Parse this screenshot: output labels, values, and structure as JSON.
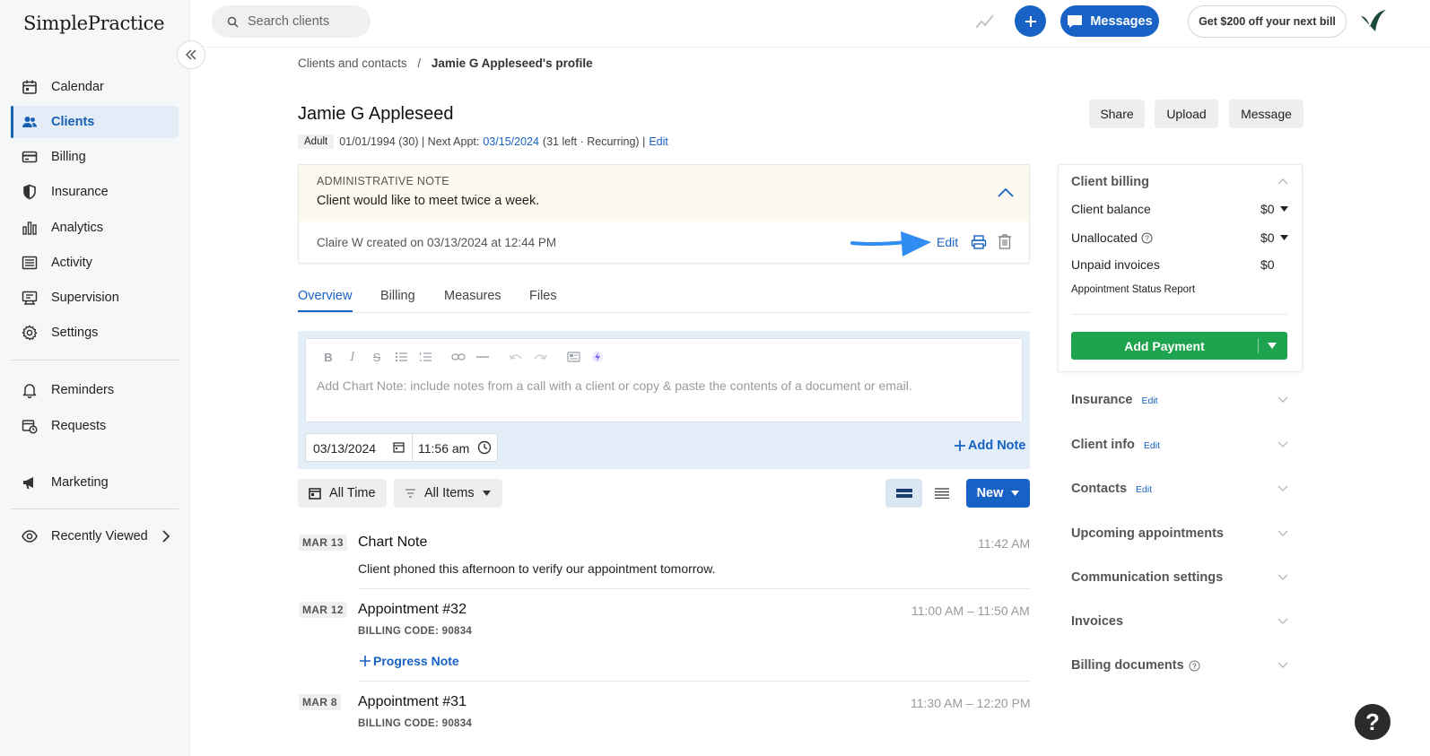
{
  "app": {
    "logo": "SimplePractice",
    "search_placeholder": "Search clients",
    "messages_label": "Messages",
    "promo_label": "Get $200 off your next bill",
    "help_label": "?"
  },
  "sidebar": {
    "items": [
      {
        "label": "Calendar",
        "icon": "calendar-icon"
      },
      {
        "label": "Clients",
        "icon": "users-icon",
        "active": true
      },
      {
        "label": "Billing",
        "icon": "credit-card-icon"
      },
      {
        "label": "Insurance",
        "icon": "shield-icon"
      },
      {
        "label": "Analytics",
        "icon": "bar-chart-icon"
      },
      {
        "label": "Activity",
        "icon": "list-icon"
      },
      {
        "label": "Supervision",
        "icon": "supervision-icon"
      },
      {
        "label": "Settings",
        "icon": "gear-icon"
      },
      {
        "label": "Reminders",
        "icon": "bell-icon"
      },
      {
        "label": "Requests",
        "icon": "calendar-clock-icon"
      },
      {
        "label": "Marketing",
        "icon": "megaphone-icon"
      },
      {
        "label": "Recently Viewed",
        "icon": "eye-icon"
      }
    ]
  },
  "breadcrumb": {
    "parent": "Clients and contacts",
    "separator": "/",
    "current": "Jamie G Appleseed's profile"
  },
  "client": {
    "name": "Jamie G Appleseed",
    "badge": "Adult",
    "dob": "01/01/1994 (30) | Next Appt:",
    "next_appt": "03/15/2024",
    "appt_suffix": "(31 left · Recurring) |",
    "edit_label": "Edit"
  },
  "header_actions": {
    "share": "Share",
    "upload": "Upload",
    "message": "Message"
  },
  "admin_note": {
    "label": "ADMINISTRATIVE NOTE",
    "text": "Client would like to meet twice a week.",
    "created": "Claire W created on 03/13/2024 at 12:44 PM",
    "edit_label": "Edit"
  },
  "tabs": [
    "Overview",
    "Billing",
    "Measures",
    "Files"
  ],
  "editor": {
    "placeholder": "Add Chart Note: include notes from a call with a client or copy & paste the contents of a document or email.",
    "date": "03/13/2024",
    "time": "11:56 am",
    "add_note_label": "Add Note"
  },
  "filters": {
    "time_label": "All Time",
    "items_label": "All Items",
    "new_label": "New"
  },
  "entries": [
    {
      "date": "MAR 13",
      "title": "Chart Note",
      "time": "11:42 AM",
      "body": "Client phoned this afternoon to verify our appointment tomorrow."
    },
    {
      "date": "MAR 12",
      "title": "Appointment #32",
      "time": "11:00 AM – 11:50 AM",
      "code": "BILLING CODE: 90834",
      "action": "Progress Note"
    },
    {
      "date": "MAR 8",
      "title": "Appointment #31",
      "time": "11:30 AM – 12:20 PM",
      "code": "BILLING CODE: 90834"
    }
  ],
  "billing": {
    "title": "Client billing",
    "balance_label": "Client balance",
    "balance_value": "$0",
    "unallocated_label": "Unallocated",
    "unallocated_value": "$0",
    "unpaid_label": "Unpaid invoices",
    "unpaid_value": "$0",
    "report_link": "Appointment Status Report",
    "add_payment_label": "Add Payment"
  },
  "sections": [
    {
      "label": "Insurance",
      "edit": "Edit"
    },
    {
      "label": "Client info",
      "edit": "Edit"
    },
    {
      "label": "Contacts",
      "edit": "Edit"
    },
    {
      "label": "Upcoming appointments"
    },
    {
      "label": "Communication settings"
    },
    {
      "label": "Invoices"
    },
    {
      "label": "Billing documents"
    }
  ],
  "colors": {
    "primary": "#1762c4",
    "success": "#1ea34e",
    "note_bg": "#fdf9ef",
    "arrow": "#2f8cf0"
  }
}
